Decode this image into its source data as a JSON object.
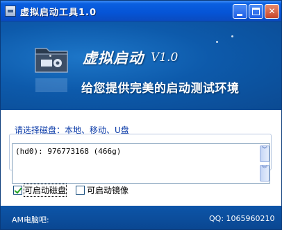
{
  "window": {
    "title": "虚拟启动工具1.0",
    "buttons": {
      "minimize_icon": "minimize-icon",
      "maximize_icon": "maximize-icon",
      "close_label": "✕"
    }
  },
  "banner": {
    "headline": "虚拟启动",
    "version": "V1.0",
    "slogan": "给您提供完美的启动测试环境",
    "logo_icon": "folder-gear-icon"
  },
  "disk_group": {
    "label": "请选择磁盘：本地、移动、U盘",
    "disks": [
      {
        "text": "(hd0): 976773168 (466g)"
      }
    ],
    "scroll_glyph": "︾"
  },
  "options": {
    "bootable_disk": {
      "label": "可启动磁盘",
      "checked": true
    },
    "bootable_image": {
      "label": "可启动镜像",
      "checked": false
    }
  },
  "status": {
    "left": "AM电脑吧:",
    "right": "QQ: 1065960210"
  },
  "colors": {
    "titlebar": "#0554d6",
    "banner": "#0d5aab",
    "group_label": "#0a3aa8",
    "check_mark": "#21a121"
  }
}
